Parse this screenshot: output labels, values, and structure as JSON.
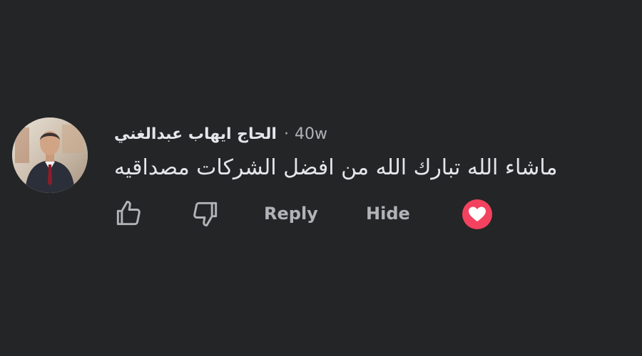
{
  "comment": {
    "author": "الحاج ايهاب عبدالغني",
    "separator": "·",
    "timestamp": "40w",
    "text": "ماشاء الله تبارك الله من افضل الشركات مصداقيه"
  },
  "actions": {
    "like_icon": "thumbs-up-icon",
    "dislike_icon": "thumbs-down-icon",
    "reply_label": "Reply",
    "hide_label": "Hide",
    "reaction_icon": "heart-icon"
  },
  "colors": {
    "background": "#242526",
    "primary_text": "#e4e6eb",
    "secondary_text": "#b0b3b8",
    "reaction_red": "#f3425f"
  }
}
